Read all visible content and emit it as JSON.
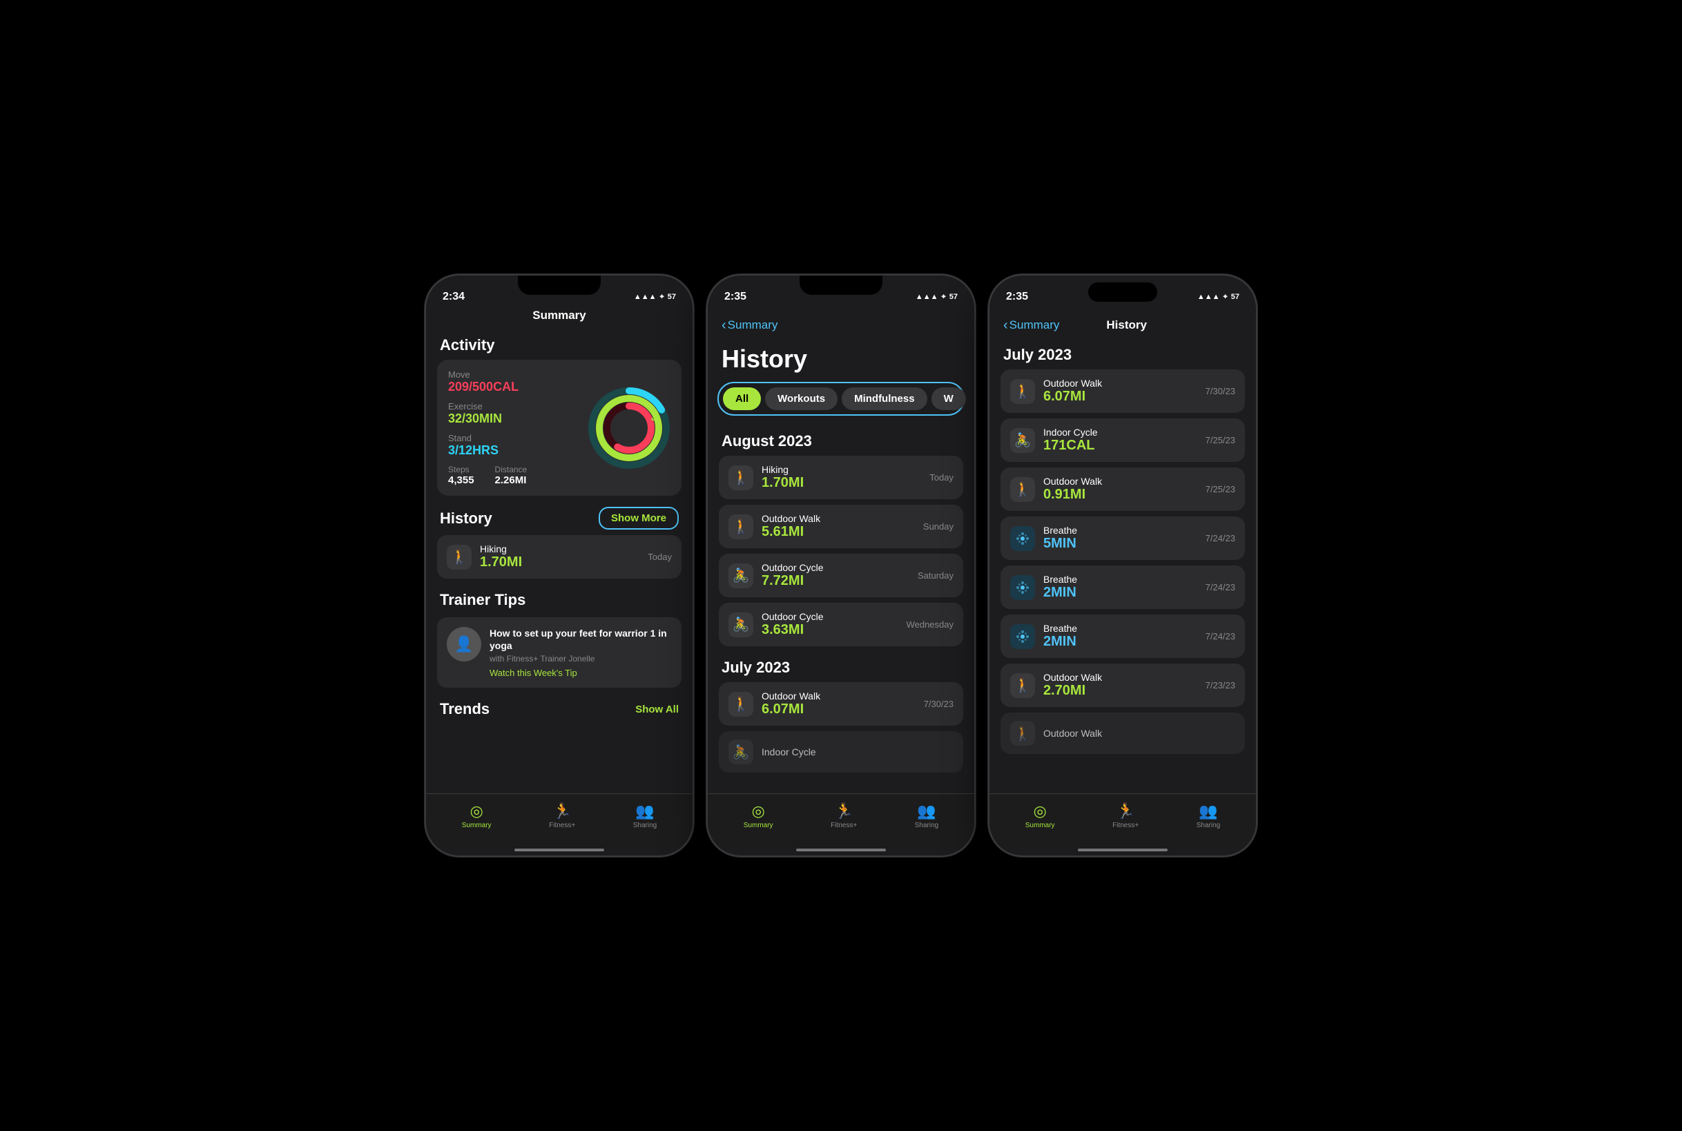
{
  "phone1": {
    "status": {
      "time": "2:34",
      "signal": "▲▲▲",
      "wifi": "WiFi",
      "battery": "57"
    },
    "header": "Summary",
    "activity": {
      "section": "Activity",
      "move_label": "Move",
      "move_val": "209/500CAL",
      "exercise_label": "Exercise",
      "exercise_val": "32/30MIN",
      "stand_label": "Stand",
      "stand_val": "3/12HRS",
      "steps_label": "Steps",
      "steps_val": "4,355",
      "distance_label": "Distance",
      "distance_val": "2.26MI"
    },
    "history": {
      "section": "History",
      "show_more": "Show More",
      "items": [
        {
          "icon": "🚶",
          "name": "Hiking",
          "val": "1.70MI",
          "date": "Today"
        }
      ]
    },
    "trainer": {
      "section": "Trainer Tips",
      "tip": "How to set up your feet for warrior 1 in yoga",
      "sub": "with Fitness+ Trainer Jonelle",
      "link": "Watch this Week's Tip"
    },
    "trends_section": "Trends",
    "tabs": [
      {
        "label": "Summary",
        "active": true
      },
      {
        "label": "Fitness+",
        "active": false
      },
      {
        "label": "Sharing",
        "active": false
      }
    ]
  },
  "phone2": {
    "status": {
      "time": "2:35",
      "signal": "▲▲▲",
      "wifi": "WiFi",
      "battery": "57"
    },
    "nav_back": "Summary",
    "page_title": "History",
    "filters": [
      {
        "label": "All",
        "active": true
      },
      {
        "label": "Workouts",
        "active": false
      },
      {
        "label": "Mindfulness",
        "active": false
      },
      {
        "label": "W",
        "active": false
      }
    ],
    "august": {
      "month": "August 2023",
      "items": [
        {
          "icon": "🚶",
          "name": "Hiking",
          "val": "1.70MI",
          "date": "Today"
        },
        {
          "icon": "🚶",
          "name": "Outdoor Walk",
          "val": "5.61MI",
          "date": "Sunday"
        },
        {
          "icon": "🚴",
          "name": "Outdoor Cycle",
          "val": "7.72MI",
          "date": "Saturday"
        },
        {
          "icon": "🚴",
          "name": "Outdoor Cycle",
          "val": "3.63MI",
          "date": "Wednesday"
        }
      ]
    },
    "july": {
      "month": "July 2023",
      "items": [
        {
          "icon": "🚶",
          "name": "Outdoor Walk",
          "val": "6.07MI",
          "date": "7/30/23"
        },
        {
          "icon": "🚴",
          "name": "Indoor Cycle",
          "val": "...",
          "date": ""
        }
      ]
    },
    "tabs": [
      {
        "label": "Summary",
        "active": true
      },
      {
        "label": "Fitness+",
        "active": false
      },
      {
        "label": "Sharing",
        "active": false
      }
    ]
  },
  "phone3": {
    "status": {
      "time": "2:35",
      "signal": "▲▲▲",
      "wifi": "WiFi",
      "battery": "57"
    },
    "nav_back": "Summary",
    "nav_title": "History",
    "month": "July 2023",
    "items": [
      {
        "type": "walk",
        "name": "Outdoor Walk",
        "val": "6.07MI",
        "val_color": "green",
        "date": "7/30/23"
      },
      {
        "type": "cycle",
        "name": "Indoor Cycle",
        "val": "171CAL",
        "val_color": "green",
        "date": "7/25/23"
      },
      {
        "type": "walk",
        "name": "Outdoor Walk",
        "val": "0.91MI",
        "val_color": "green",
        "date": "7/25/23"
      },
      {
        "type": "breathe",
        "name": "Breathe",
        "val": "5MIN",
        "val_color": "blue",
        "date": "7/24/23"
      },
      {
        "type": "breathe",
        "name": "Breathe",
        "val": "2MIN",
        "val_color": "blue",
        "date": "7/24/23"
      },
      {
        "type": "breathe",
        "name": "Breathe",
        "val": "2MIN",
        "val_color": "blue",
        "date": "7/24/23"
      },
      {
        "type": "walk",
        "name": "Outdoor Walk",
        "val": "2.70MI",
        "val_color": "green",
        "date": "7/23/23"
      },
      {
        "type": "walk",
        "name": "Outdoor Walk",
        "val": "...",
        "val_color": "green",
        "date": ""
      }
    ],
    "tabs": [
      {
        "label": "Summary",
        "active": true
      },
      {
        "label": "Fitness+",
        "active": false
      },
      {
        "label": "Sharing",
        "active": false
      }
    ]
  }
}
